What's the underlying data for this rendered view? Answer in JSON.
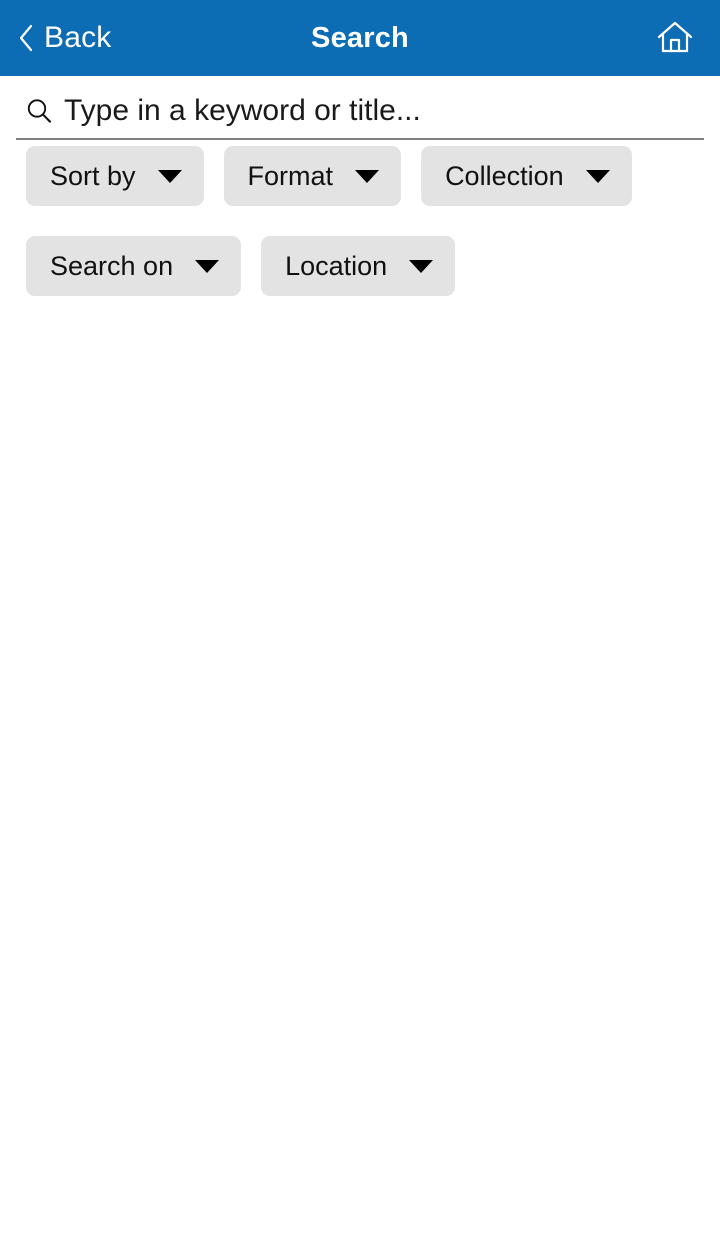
{
  "header": {
    "background_color": "#0c6db5",
    "back_label": "Back",
    "back_icon": "chevron-left-icon",
    "title": "Search",
    "home_icon": "home-icon"
  },
  "search": {
    "icon": "search-icon",
    "value": "",
    "placeholder": "Type in a keyword or title..."
  },
  "filters": {
    "chip_background_color": "#e3e3e3",
    "caret_icon": "caret-down-icon",
    "rows": [
      [
        {
          "label": "Sort by"
        },
        {
          "label": "Format"
        },
        {
          "label": "Collection"
        }
      ],
      [
        {
          "label": "Search on"
        },
        {
          "label": "Location"
        }
      ]
    ]
  },
  "results": {
    "items": []
  }
}
